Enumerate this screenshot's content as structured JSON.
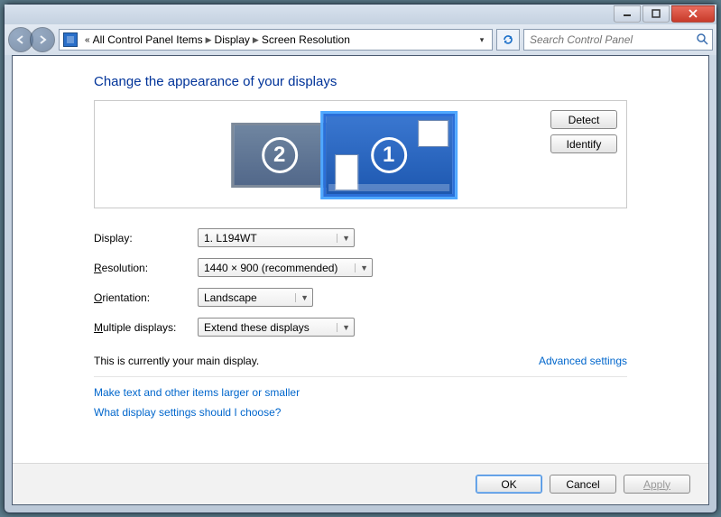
{
  "breadcrumbs": {
    "item0": "All Control Panel Items",
    "item1": "Display",
    "item2": "Screen Resolution"
  },
  "search": {
    "placeholder": "Search Control Panel"
  },
  "page": {
    "title": "Change the appearance of your displays"
  },
  "buttons": {
    "detect": "Detect",
    "identify": "Identify",
    "ok": "OK",
    "cancel": "Cancel",
    "apply": "Apply"
  },
  "monitors": {
    "primary_number": "1",
    "secondary_number": "2"
  },
  "form": {
    "display_label_pre": "D",
    "display_label_post": "isplay:",
    "display_value": "1. L194WT",
    "resolution_label_pre": "R",
    "resolution_label_post": "esolution:",
    "resolution_value": "1440 × 900 (recommended)",
    "orientation_label_pre": "O",
    "orientation_label_post": "rientation:",
    "orientation_value": "Landscape",
    "multiple_label_pre": "M",
    "multiple_label_post": "ultiple displays:",
    "multiple_value": "Extend these displays"
  },
  "messages": {
    "main_display": "This is currently your main display.",
    "advanced": "Advanced settings",
    "link1": "Make text and other items larger or smaller",
    "link2": "What display settings should I choose?"
  }
}
